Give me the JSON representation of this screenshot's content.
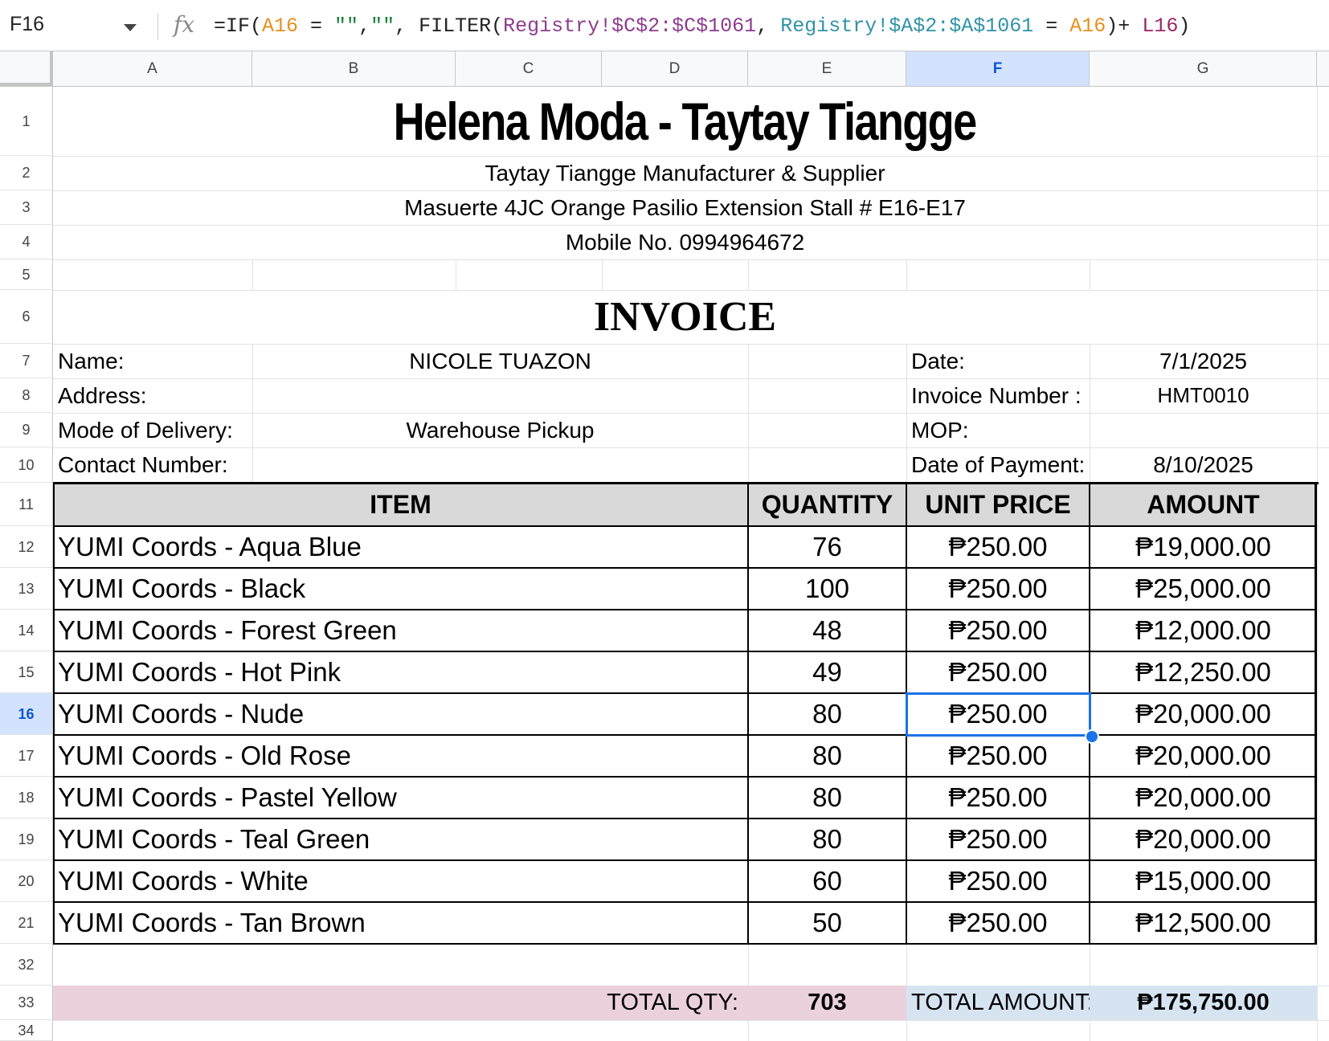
{
  "formula_bar": {
    "name_box": "F16",
    "fx": "fx",
    "parts": [
      {
        "t": "=IF(",
        "c": ""
      },
      {
        "t": "A16",
        "c": "f-orange"
      },
      {
        "t": " = ",
        "c": ""
      },
      {
        "t": "\"\"",
        "c": "f-green"
      },
      {
        "t": ",",
        "c": ""
      },
      {
        "t": "\"\"",
        "c": "f-green"
      },
      {
        "t": ", FILTER(",
        "c": ""
      },
      {
        "t": "Registry!$C$2:$C$1061",
        "c": "f-purple"
      },
      {
        "t": ", ",
        "c": ""
      },
      {
        "t": "Registry!$A$2:$A$1061",
        "c": "f-teal"
      },
      {
        "t": " = ",
        "c": ""
      },
      {
        "t": "A16",
        "c": "f-orange"
      },
      {
        "t": ")+ ",
        "c": ""
      },
      {
        "t": "L16",
        "c": "f-plum"
      },
      {
        "t": ")",
        "c": ""
      }
    ]
  },
  "columns": [
    "A",
    "B",
    "C",
    "D",
    "E",
    "F",
    "G"
  ],
  "selected_column": "F",
  "row_numbers": [
    "1",
    "2",
    "3",
    "4",
    "5",
    "6",
    "7",
    "8",
    "9",
    "10",
    "11",
    "12",
    "13",
    "14",
    "15",
    "16",
    "17",
    "18",
    "19",
    "20",
    "21",
    "32",
    "33",
    "34"
  ],
  "selected_row": "16",
  "header": {
    "shop_name": "Helena Moda - Taytay Tiangge",
    "tagline": "Taytay Tiangge Manufacturer & Supplier",
    "address": "Masuerte 4JC Orange Pasilio Extension Stall # E16-E17",
    "mobile": "Mobile No. 0994964672",
    "doc_title": "INVOICE"
  },
  "customer": {
    "name_label": "Name:",
    "name_value": "NICOLE TUAZON",
    "address_label": "Address:",
    "address_value": "",
    "delivery_label": "Mode of Delivery:",
    "delivery_value": "Warehouse Pickup",
    "contact_label": "Contact Number:",
    "contact_value": ""
  },
  "invoice_meta": {
    "date_label": "Date:",
    "date_value": "7/1/2025",
    "number_label": "Invoice Number :",
    "number_value": "HMT0010",
    "mop_label": "MOP:",
    "mop_value": "",
    "payment_date_label": "Date of Payment:",
    "payment_date_value": "8/10/2025"
  },
  "table": {
    "headers": [
      "ITEM",
      "QUANTITY",
      "UNIT PRICE",
      "AMOUNT"
    ],
    "rows": [
      {
        "item": "YUMI Coords - Aqua Blue",
        "qty": "76",
        "price": "₱250.00",
        "amount": "₱19,000.00"
      },
      {
        "item": "YUMI Coords - Black",
        "qty": "100",
        "price": "₱250.00",
        "amount": "₱25,000.00"
      },
      {
        "item": "YUMI Coords - Forest Green",
        "qty": "48",
        "price": "₱250.00",
        "amount": "₱12,000.00"
      },
      {
        "item": "YUMI Coords - Hot Pink",
        "qty": "49",
        "price": "₱250.00",
        "amount": "₱12,250.00"
      },
      {
        "item": "YUMI Coords - Nude",
        "qty": "80",
        "price": "₱250.00",
        "amount": "₱20,000.00"
      },
      {
        "item": "YUMI Coords - Old Rose",
        "qty": "80",
        "price": "₱250.00",
        "amount": "₱20,000.00"
      },
      {
        "item": "YUMI Coords - Pastel Yellow",
        "qty": "80",
        "price": "₱250.00",
        "amount": "₱20,000.00"
      },
      {
        "item": "YUMI Coords - Teal Green",
        "qty": "80",
        "price": "₱250.00",
        "amount": "₱20,000.00"
      },
      {
        "item": "YUMI Coords - White",
        "qty": "60",
        "price": "₱250.00",
        "amount": "₱15,000.00"
      },
      {
        "item": "YUMI Coords - Tan Brown",
        "qty": "50",
        "price": "₱250.00",
        "amount": "₱12,500.00"
      }
    ]
  },
  "totals": {
    "qty_label": "TOTAL QTY:",
    "qty_value": "703",
    "amount_label": "TOTAL AMOUNT:",
    "amount_value": "₱175,750.00"
  },
  "colors": {
    "selection": "#1a73e8",
    "header_fill": "#d9d9d9",
    "total_qty_fill": "#ead1dc",
    "total_amount_fill": "#d6e4f2"
  }
}
